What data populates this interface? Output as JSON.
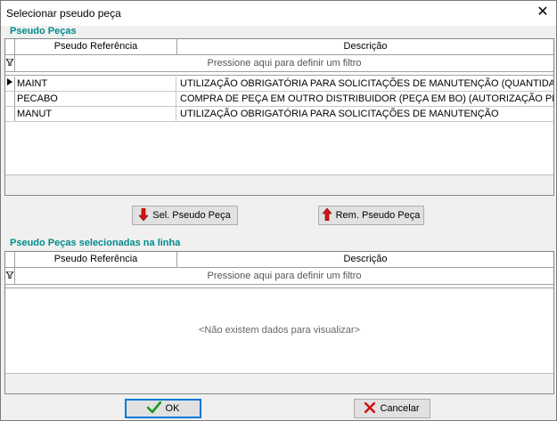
{
  "window": {
    "title": "Selecionar pseudo peça",
    "close_glyph": "✕"
  },
  "top_section": {
    "label": "Pseudo Peças",
    "columns": [
      "Pseudo Referência",
      "Descrição"
    ],
    "filter_text": "Pressione aqui para definir um filtro",
    "rows": [
      {
        "ref": "MAINT",
        "desc": "UTILIZAÇÃO OBRIGATÓRIA PARA SOLICITAÇÕES DE MANUTENÇÃO (QUANTIDADE ZERO)"
      },
      {
        "ref": "PECABO",
        "desc": "COMPRA DE PEÇA EM OUTRO DISTRIBUIDOR (PEÇA EM BO) (AUTORIZAÇÃO PRÉVIA)"
      },
      {
        "ref": "MANUT",
        "desc": "UTILIZAÇÃO OBRIGATÓRIA PARA SOLICITAÇÕES DE MANUTENÇÃO"
      }
    ]
  },
  "buttons": {
    "select": "Sel. Pseudo Peça",
    "remove": "Rem. Pseudo Peça",
    "ok": "OK",
    "cancel": "Cancelar"
  },
  "bottom_section": {
    "label": "Pseudo Peças selecionadas na linha",
    "columns": [
      "Pseudo Referência",
      "Descrição"
    ],
    "filter_text": "Pressione aqui para definir um filtro",
    "empty_text": "<Não existem dados para visualizar>"
  },
  "icons": {
    "down_arrow": "red-down-arrow-icon",
    "up_arrow": "red-up-arrow-icon",
    "check": "green-check-icon",
    "cancel": "red-x-icon",
    "filter": "filter-funnel-icon",
    "row_indicator": "current-row-arrow-icon"
  },
  "colors": {
    "section_label": "#008b8b",
    "accent_border": "#0078d7"
  }
}
